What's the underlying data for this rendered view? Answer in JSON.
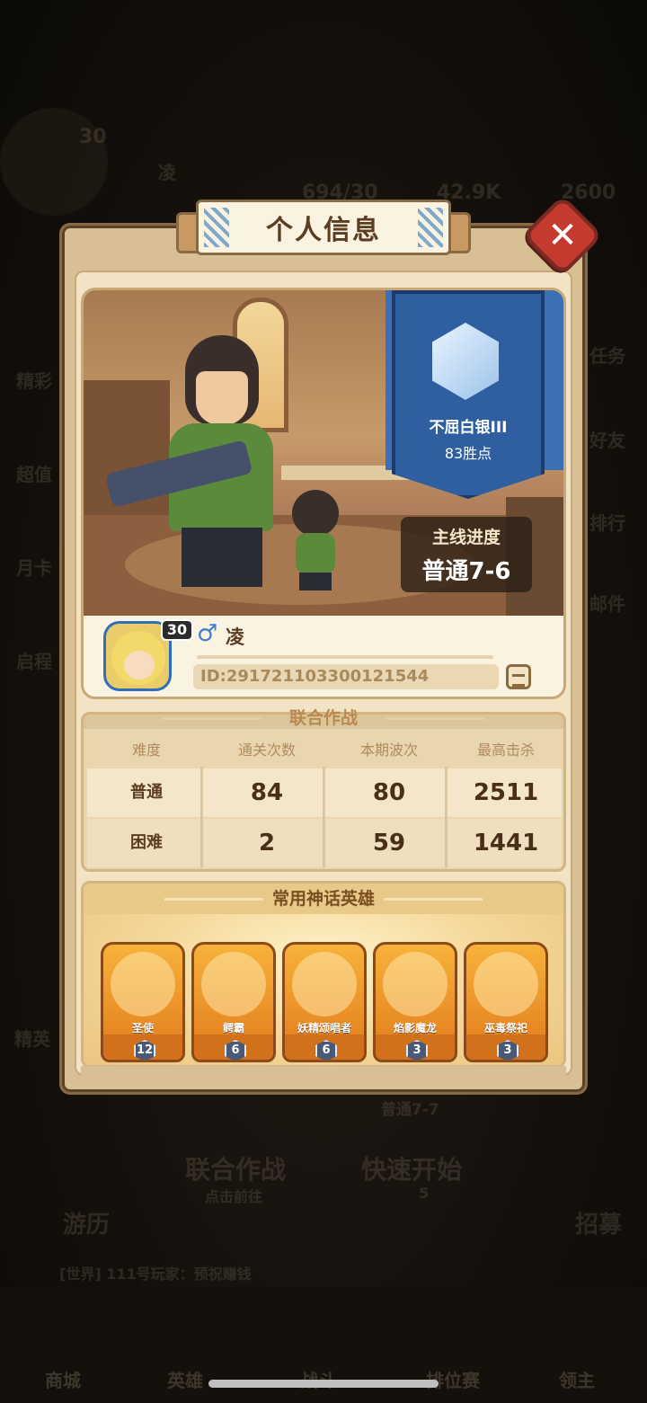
{
  "background": {
    "labels": [
      "30",
      "凌",
      "694/30",
      "42.9K",
      "2600",
      "精彩",
      "超值",
      "月卡",
      "启程",
      "任务",
      "好友",
      "排行",
      "邮件",
      "精英",
      "普通7-7",
      "联合作战",
      "点击前往",
      "快速开始",
      "5",
      "游历",
      "招募",
      "[世界] 111号玩家：预祝赚钱"
    ],
    "nav": [
      "商城",
      "英雄",
      "战斗",
      "排位赛",
      "领主"
    ]
  },
  "dialog": {
    "title": "个人信息",
    "close_icon": "close-icon"
  },
  "profile": {
    "rank_name": "不屈白银III",
    "rank_points": "83胜点",
    "progress_label": "主线进度",
    "progress_value": "普通7-6",
    "level": "30",
    "gender_symbol": "♂",
    "player_name": "凌",
    "player_id": "ID:291721103300121544"
  },
  "coop": {
    "title": "联合作战",
    "headers": [
      "难度",
      "通关次数",
      "本期波次",
      "最高击杀"
    ],
    "rows": [
      [
        "普通",
        "84",
        "80",
        "2511"
      ],
      [
        "困难",
        "2",
        "59",
        "1441"
      ]
    ]
  },
  "heroes": {
    "title": "常用神话英雄",
    "items": [
      {
        "name": "圣使",
        "level": "12"
      },
      {
        "name": "鳄霸",
        "level": "6"
      },
      {
        "name": "妖精颂唱者",
        "level": "6"
      },
      {
        "name": "焰影魔龙",
        "level": "3"
      },
      {
        "name": "巫毒祭祀",
        "level": "3"
      }
    ]
  },
  "colors": {
    "panel": "#d9bf94",
    "close": "#c43a2e",
    "banner": "#2f5fa0",
    "hero_card": "#f7b23a"
  }
}
